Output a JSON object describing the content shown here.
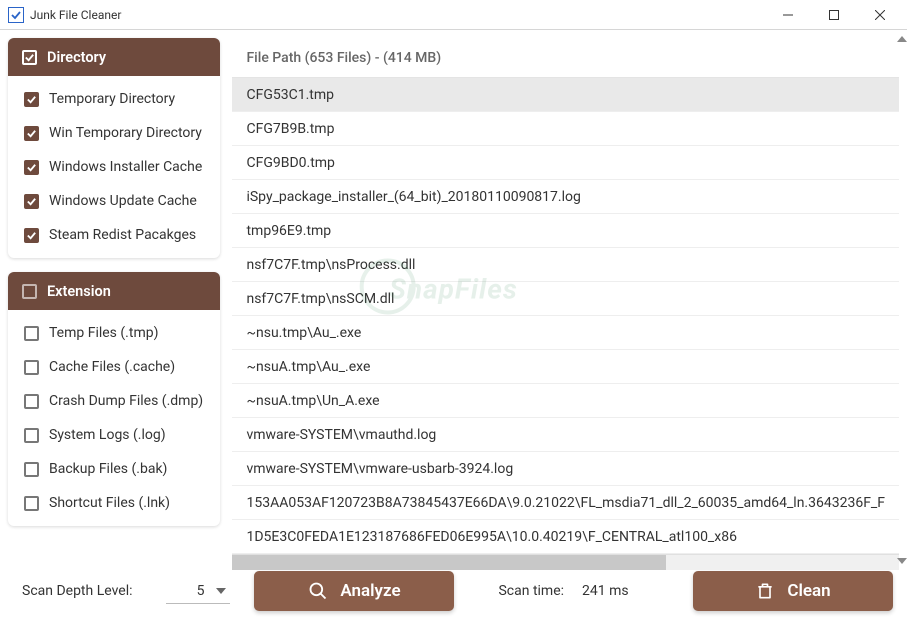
{
  "window": {
    "title": "Junk File Cleaner"
  },
  "sidebar": {
    "directory": {
      "title": "Directory",
      "checked": true,
      "items": [
        {
          "label": "Temporary Directory",
          "checked": true
        },
        {
          "label": "Win Temporary Directory",
          "checked": true
        },
        {
          "label": "Windows Installer Cache",
          "checked": true
        },
        {
          "label": "Windows Update Cache",
          "checked": true
        },
        {
          "label": "Steam Redist Pacakges",
          "checked": true
        }
      ]
    },
    "extension": {
      "title": "Extension",
      "checked": false,
      "items": [
        {
          "label": "Temp Files (.tmp)",
          "checked": false
        },
        {
          "label": "Cache Files (.cache)",
          "checked": false
        },
        {
          "label": "Crash Dump Files (.dmp)",
          "checked": false
        },
        {
          "label": "System Logs (.log)",
          "checked": false
        },
        {
          "label": "Backup Files (.bak)",
          "checked": false
        },
        {
          "label": "Shortcut Files (.lnk)",
          "checked": false
        }
      ]
    }
  },
  "filelist": {
    "header": "File Path (653 Files) - (414 MB)",
    "rows": [
      "CFG53C1.tmp",
      "CFG7B9B.tmp",
      "CFG9BD0.tmp",
      "iSpy_package_installer_(64_bit)_20180110090817.log",
      "tmp96E9.tmp",
      "nsf7C7F.tmp\\nsProcess.dll",
      "nsf7C7F.tmp\\nsSCM.dll",
      "~nsu.tmp\\Au_.exe",
      "~nsuA.tmp\\Au_.exe",
      "~nsuA.tmp\\Un_A.exe",
      "vmware-SYSTEM\\vmauthd.log",
      "vmware-SYSTEM\\vmware-usbarb-3924.log",
      "153AA053AF120723B8A73845437E66DA\\9.0.21022\\FL_msdia71_dll_2_60035_amd64_ln.3643236F_F",
      "1D5E3C0FEDA1E123187686FED06E995A\\10.0.40219\\F_CENTRAL_atl100_x86"
    ],
    "selected_index": 0
  },
  "bottom": {
    "depth_label": "Scan Depth Level:",
    "depth_value": "5",
    "analyze_label": "Analyze",
    "clean_label": "Clean",
    "scan_time_label": "Scan time:",
    "scan_time_value": "241 ms"
  },
  "watermark": "SnapFiles"
}
